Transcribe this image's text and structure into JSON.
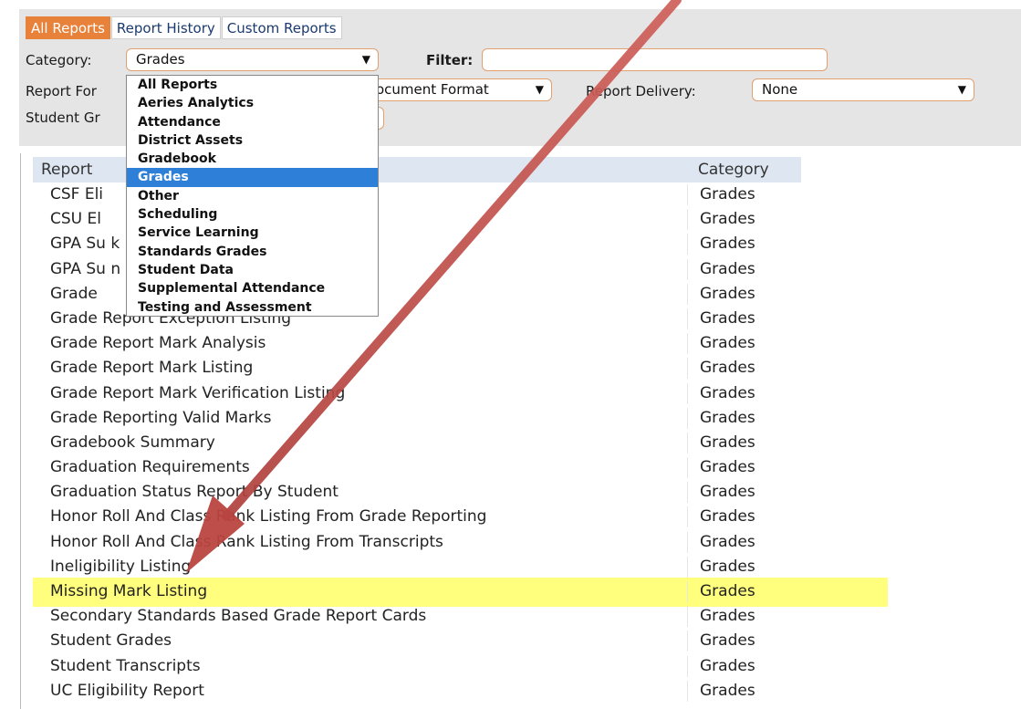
{
  "tabs": [
    "All Reports",
    "Report History",
    "Custom Reports"
  ],
  "filters": {
    "category_label": "Category:",
    "category_value": "Grades",
    "filter_label": "Filter:",
    "filter_value": "",
    "report_format_label": "Report For",
    "document_format_value": "ocument Format",
    "report_delivery_label": "Report Delivery:",
    "report_delivery_value": "None",
    "student_group_label": "Student Gr"
  },
  "category_dropdown": {
    "options": [
      "All Reports",
      "Aeries Analytics",
      "Attendance",
      "District Assets",
      "Gradebook",
      "Grades",
      "Other",
      "Scheduling",
      "Service Learning",
      "Standards Grades",
      "Student Data",
      "Supplemental Attendance",
      "Testing and Assessment"
    ],
    "selected": "Grades"
  },
  "table": {
    "headers": [
      "Report",
      "Category"
    ],
    "rows": [
      {
        "name": "CSF Eli",
        "category": "Grades"
      },
      {
        "name": "CSU El",
        "category": "Grades"
      },
      {
        "name": "GPA Su                    k (GRD)",
        "category": "Grades"
      },
      {
        "name": "GPA Su                    n (HIS)",
        "category": "Grades"
      },
      {
        "name": "Grade",
        "category": "Grades"
      },
      {
        "name": "Grade Report Exception Listing",
        "category": "Grades"
      },
      {
        "name": "Grade Report Mark Analysis",
        "category": "Grades"
      },
      {
        "name": "Grade Report Mark Listing",
        "category": "Grades"
      },
      {
        "name": "Grade Report Mark Verification Listing",
        "category": "Grades"
      },
      {
        "name": "Grade Reporting Valid Marks",
        "category": "Grades"
      },
      {
        "name": "Gradebook Summary",
        "category": "Grades"
      },
      {
        "name": "Graduation Requirements",
        "category": "Grades"
      },
      {
        "name": "Graduation Status Report By Student",
        "category": "Grades"
      },
      {
        "name": "Honor Roll And Class Rank Listing From Grade Reporting",
        "category": "Grades"
      },
      {
        "name": "Honor Roll And Class Rank Listing From Transcripts",
        "category": "Grades"
      },
      {
        "name": "Ineligibility Listing",
        "category": "Grades"
      },
      {
        "name": "Missing Mark Listing",
        "category": "Grades"
      },
      {
        "name": "Secondary Standards Based Grade Report Cards",
        "category": "Grades"
      },
      {
        "name": "Student Grades",
        "category": "Grades"
      },
      {
        "name": "Student Transcripts",
        "category": "Grades"
      },
      {
        "name": "UC Eligibility Report",
        "category": "Grades"
      }
    ],
    "highlighted_row": "Missing Mark Listing"
  },
  "colors": {
    "active_tab": "#e8813a",
    "highlight": "#ffff66",
    "arrow": "#c0504d",
    "dropdown_selected": "#2d7fd8"
  }
}
